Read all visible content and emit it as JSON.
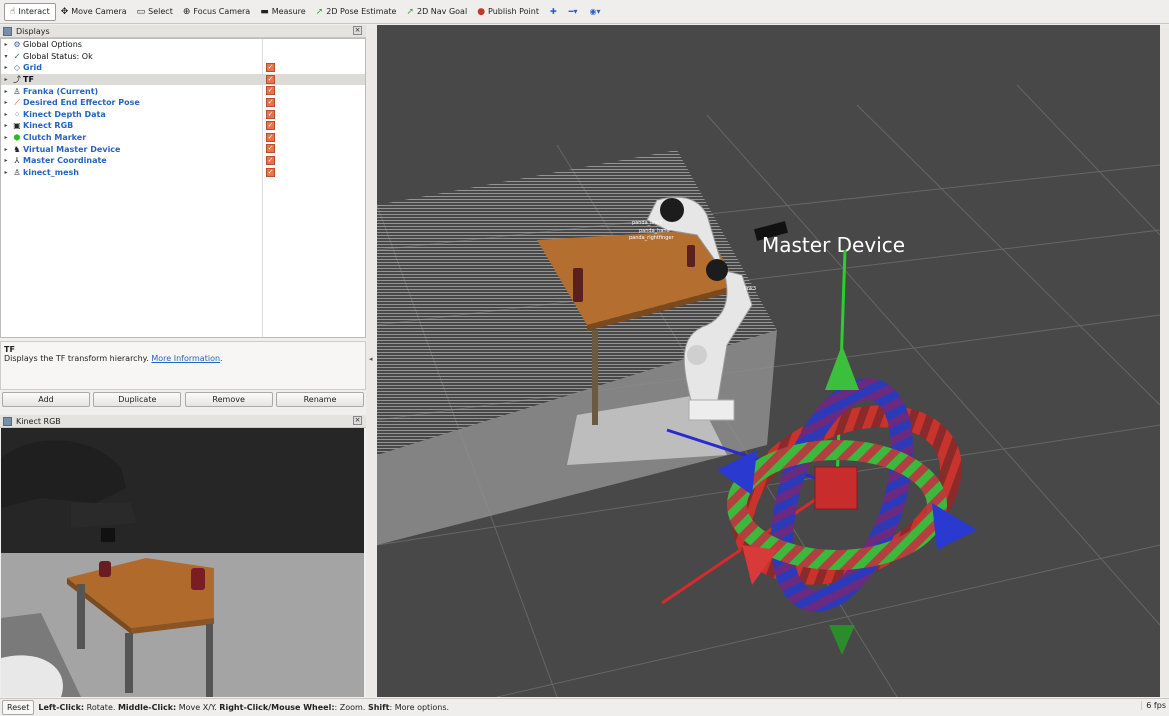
{
  "toolbar": {
    "tools": [
      {
        "label": "Interact",
        "icon": "hand-icon",
        "glyph": "☝",
        "active": true
      },
      {
        "label": "Move Camera",
        "icon": "move-camera-icon",
        "glyph": "✥"
      },
      {
        "label": "Select",
        "icon": "select-icon",
        "glyph": "▭"
      },
      {
        "label": "Focus Camera",
        "icon": "focus-camera-icon",
        "glyph": "⊕"
      },
      {
        "label": "Measure",
        "icon": "measure-icon",
        "glyph": "▬"
      },
      {
        "label": "2D Pose Estimate",
        "icon": "pose-estimate-icon",
        "glyph": "➚"
      },
      {
        "label": "2D Nav Goal",
        "icon": "nav-goal-icon",
        "glyph": "➚"
      },
      {
        "label": "Publish Point",
        "icon": "publish-point-icon",
        "glyph": "●"
      }
    ],
    "extra": [
      {
        "icon": "add-tool-icon",
        "glyph": "✚"
      },
      {
        "icon": "remove-tool-icon",
        "glyph": "━▾"
      },
      {
        "icon": "view-options-icon",
        "glyph": "◉▾"
      }
    ]
  },
  "displays_panel": {
    "title": "Displays",
    "items": [
      {
        "label": "Global Options",
        "icon": "gear-icon",
        "glyph": "⚙",
        "style": "plain",
        "checked": false,
        "expanded": false
      },
      {
        "label": "Global Status: Ok",
        "icon": "check-icon",
        "glyph": "✓",
        "style": "plain",
        "checked": false,
        "expanded": true
      },
      {
        "label": "Grid",
        "icon": "grid-icon",
        "glyph": "◇",
        "style": "bold",
        "checked": true
      },
      {
        "label": "TF",
        "icon": "tf-icon",
        "glyph": "⤴",
        "style": "bold-dark",
        "checked": true,
        "selected": true
      },
      {
        "label": "Franka (Current)",
        "icon": "robot-model-icon",
        "glyph": "♙",
        "style": "bold",
        "checked": true
      },
      {
        "label": "Desired End Effector Pose",
        "icon": "pose-icon",
        "glyph": "⟋",
        "style": "bold",
        "checked": true
      },
      {
        "label": "Kinect Depth Data",
        "icon": "pointcloud-icon",
        "glyph": "⁘",
        "style": "bold",
        "checked": true
      },
      {
        "label": "Kinect RGB",
        "icon": "image-icon",
        "glyph": "▣",
        "style": "bold",
        "checked": true
      },
      {
        "label": "Clutch Marker",
        "icon": "marker-icon",
        "glyph": "⬢",
        "style": "bold",
        "checked": true
      },
      {
        "label": "Virtual Master Device",
        "icon": "interactive-marker-icon",
        "glyph": "♞",
        "style": "bold",
        "checked": true
      },
      {
        "label": "Master Coordinate",
        "icon": "axes-icon",
        "glyph": "⅄",
        "style": "bold",
        "checked": true
      },
      {
        "label": "kinect_mesh",
        "icon": "robot-model-icon",
        "glyph": "♙",
        "style": "bold",
        "checked": true
      }
    ]
  },
  "description": {
    "title": "TF",
    "text": "Displays the TF transform hierarchy.",
    "link": "More Information"
  },
  "buttons": {
    "add": "Add",
    "duplicate": "Duplicate",
    "remove": "Remove",
    "rename": "Rename"
  },
  "kinect_panel": {
    "title": "Kinect RGB"
  },
  "viewport": {
    "label_text": "Master  Device",
    "frame_labels": [
      "panda_link7",
      "panda_hand",
      "panda_rightfinger",
      "link3"
    ]
  },
  "status": {
    "reset": "Reset",
    "segments": [
      {
        "b": "Left-Click:",
        "t": " Rotate. "
      },
      {
        "b": "Middle-Click:",
        "t": " Move X/Y. "
      },
      {
        "b": "Right-Click/Mouse Wheel:",
        "t": ": Zoom. "
      },
      {
        "b": "Shift",
        "t": ": More options."
      }
    ],
    "fps": "6 fps"
  },
  "colors": {
    "accent": "#2763c2",
    "check": "#e8734a",
    "viewport_bg": "#4a4a4a"
  }
}
